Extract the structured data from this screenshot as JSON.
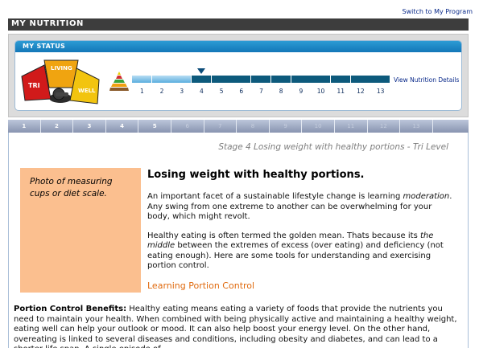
{
  "topbar": {
    "switch_link": "Switch to My Program"
  },
  "header": {
    "title": "MY NUTRITION"
  },
  "status": {
    "title": "MY STATUS",
    "logo_words": {
      "tri": "TRI",
      "living": "LIVING",
      "well": "WELL"
    },
    "current_stage": 4,
    "stages": [
      "1",
      "2",
      "3",
      "4",
      "5",
      "6",
      "7",
      "8",
      "9",
      "10",
      "11",
      "12",
      "13"
    ],
    "view_link": "View Nutrition Details"
  },
  "tabs": [
    "1",
    "2",
    "3",
    "4",
    "5",
    "6",
    "7",
    "8",
    "9",
    "10",
    "11",
    "12",
    "13"
  ],
  "unlocked_tabs": 5,
  "content": {
    "stage_caption": "Stage 4 Losing weight with healthy portions - Tri Level",
    "photo_caption": "Photo of measuring cups or diet scale.",
    "heading": "Losing weight with healthy portions.",
    "p1_before": "An important facet of a sustainable lifestyle change is learning ",
    "p1_em": "moderation",
    "p1_after": ". Any swing from one extreme to another can be overwhelming for your body, which might revolt.",
    "p2_before": "Healthy eating is often termed the golden mean. Thats because its ",
    "p2_em": "the middle",
    "p2_after": " between the extremes of excess (over eating) and deficiency (not eating enough). Here are some tools for understanding and exercising portion control.",
    "link": "Learning Portion Control",
    "benefits_label": "Portion Control Benefits:",
    "benefits_text": " Healthy eating means eating a variety of foods that provide the nutrients you need to maintain your health. When combined with being physically active and maintaining a healthy weight, eating well can help your outlook or mood. It can also help boost your energy level. On the other hand, overeating is linked to several diseases and conditions, including obesity and diabetes, and can lead to a shorter life span. A single episode of"
  },
  "colors": {
    "header_bg": "#3d3d3d",
    "status_head": "#1377b8",
    "stage_done": "#5aaede",
    "stage_todo": "#0d5a7c",
    "link_orange": "#e06a0e",
    "photo_bg": "#fbbf8f"
  }
}
